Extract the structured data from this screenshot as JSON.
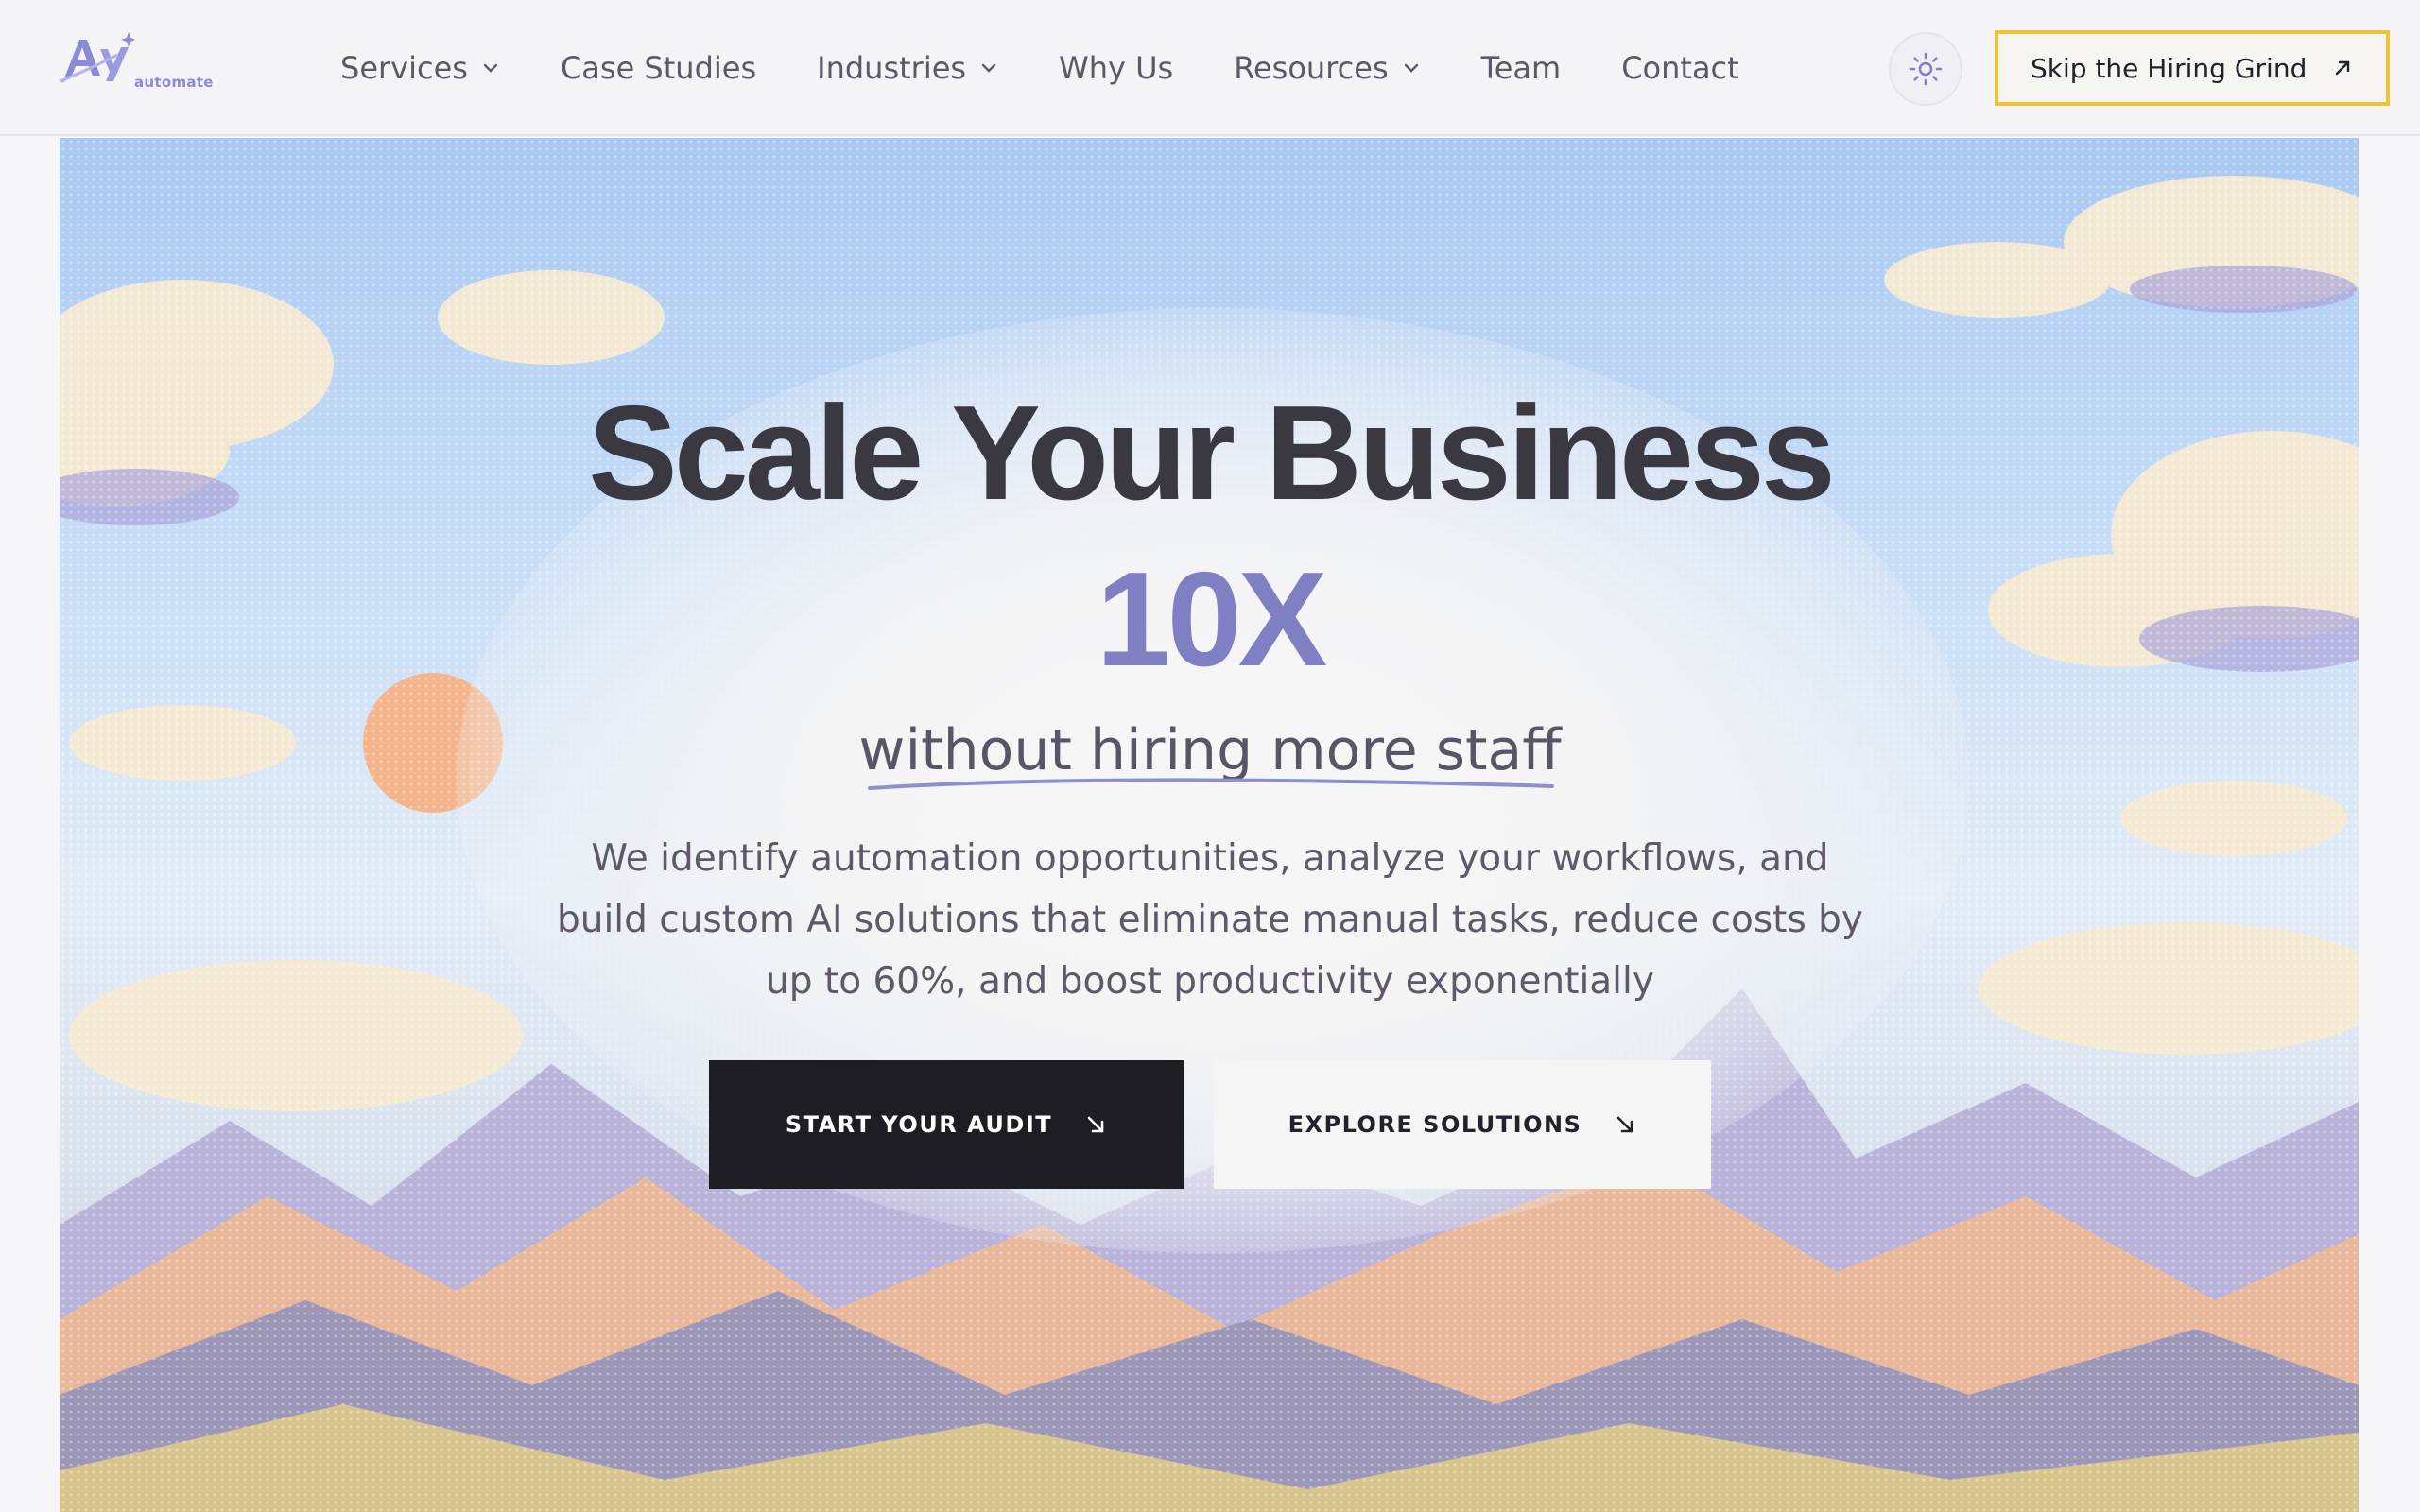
{
  "brand": {
    "logo_text": "automate",
    "colors": {
      "accent": "#7f7fc4",
      "cta_border": "#f3c23b",
      "dark": "#1f1d24"
    }
  },
  "nav": {
    "items": [
      {
        "label": "Services",
        "has_dropdown": true
      },
      {
        "label": "Case Studies",
        "has_dropdown": false
      },
      {
        "label": "Industries",
        "has_dropdown": true
      },
      {
        "label": "Why Us",
        "has_dropdown": false
      },
      {
        "label": "Resources",
        "has_dropdown": true
      },
      {
        "label": "Team",
        "has_dropdown": false
      },
      {
        "label": "Contact",
        "has_dropdown": false
      }
    ],
    "theme_toggle_icon": "sun-icon",
    "cta_label": "Skip the Hiring Grind",
    "cta_icon": "arrow-up-right-icon"
  },
  "hero": {
    "headline": "Scale Your Business",
    "accent": "10X",
    "tagline": "without hiring more staff",
    "description": "We identify automation opportunities, analyze your workflows, and build custom AI solutions that eliminate manual tasks, reduce costs by up to 60%, and boost productivity exponentially",
    "primary_button": "START YOUR AUDIT",
    "secondary_button": "EXPLORE SOLUTIONS",
    "button_icon": "arrow-down-right-icon"
  }
}
